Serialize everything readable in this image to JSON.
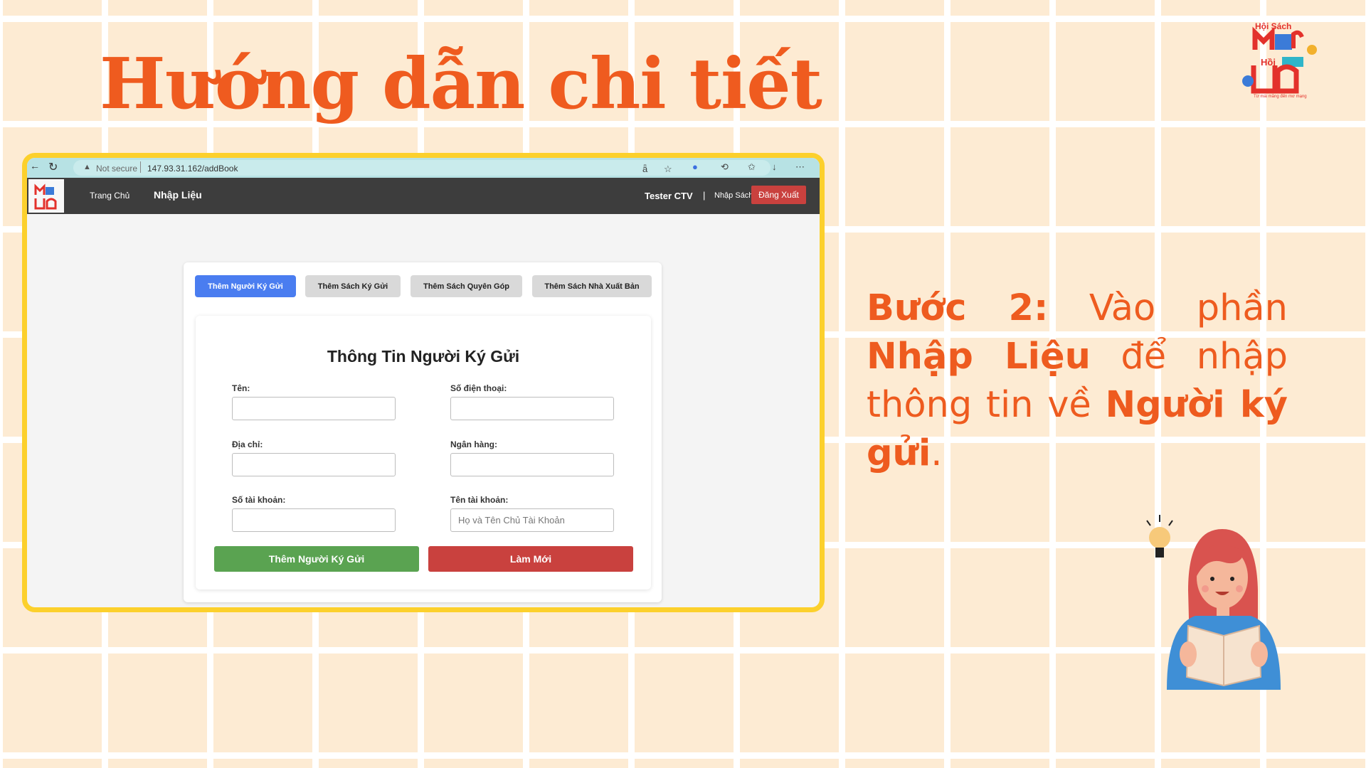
{
  "slide": {
    "title": "Hướng dẫn chi tiết",
    "step_label": "Bước 2:",
    "step_text_1": " Vào phần ",
    "step_bold_1": "Nhập Liệu",
    "step_text_2": " để nhập thông tin về ",
    "step_bold_2": "Người ký gửi",
    "step_text_3": "."
  },
  "logo": {
    "top_text": "Hội Sách",
    "mid_text": "Hồi",
    "sub_text": "Từ mái măng đến mơ mạng"
  },
  "browser": {
    "security": "Not secure",
    "url": "147.93.31.162/addBook"
  },
  "navbar": {
    "home": "Trang Chủ",
    "data_entry": "Nhập Liệu",
    "user": "Tester CTV",
    "separator": "|",
    "book_entry": "Nhập Sách",
    "logout": "Đăng Xuất"
  },
  "tabs": [
    {
      "label": "Thêm Người Ký Gửi",
      "active": true
    },
    {
      "label": "Thêm Sách Ký Gửi",
      "active": false
    },
    {
      "label": "Thêm Sách Quyên Góp",
      "active": false
    },
    {
      "label": "Thêm Sách Nhà Xuất Bản",
      "active": false
    }
  ],
  "form": {
    "title": "Thông Tin Người Ký Gửi",
    "name_label": "Tên:",
    "phone_label": "Số điện thoại:",
    "address_label": "Địa chỉ:",
    "bank_label": "Ngân hàng:",
    "account_number_label": "Số tài khoản:",
    "account_name_label": "Tên tài khoản:",
    "account_name_placeholder": "Họ và Tên Chủ Tài Khoản",
    "name_value": "",
    "phone_value": "",
    "address_value": "",
    "bank_value": "",
    "account_number_value": "",
    "account_name_value": "",
    "submit": "Thêm Người Ký Gửi",
    "reset": "Làm Mới"
  },
  "colors": {
    "accent_orange": "#ef5b1f",
    "frame_yellow": "#fcd02c",
    "tab_active": "#4a7df0",
    "submit_green": "#5aa351",
    "reset_red": "#c9413e"
  }
}
